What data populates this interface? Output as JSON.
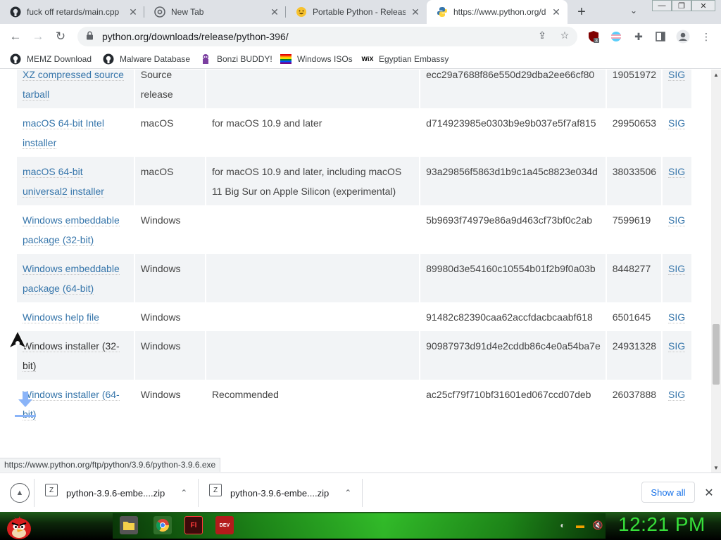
{
  "tabs": [
    {
      "title": "fuck off retards/main.cpp",
      "icon": "github-icon"
    },
    {
      "title": "New Tab",
      "icon": "chrome-icon"
    },
    {
      "title": "Portable Python - Release",
      "icon": "emoji-face-icon"
    },
    {
      "title": "https://www.python.org/d",
      "icon": "python-icon",
      "active": true
    }
  ],
  "address_bar": {
    "url": "python.org/downloads/release/python-396/"
  },
  "extensions": {
    "ublock_badge": "3"
  },
  "bookmarks": [
    {
      "label": "MEMZ Download",
      "icon": "github-icon"
    },
    {
      "label": "Malware Database",
      "icon": "github-icon"
    },
    {
      "label": "Bonzi BUDDY!",
      "icon": "bonzi-icon"
    },
    {
      "label": "Windows ISOs",
      "icon": "rainbow-flag-icon"
    },
    {
      "label": "Egyptian Embassy",
      "icon": "wix-icon"
    }
  ],
  "files": [
    {
      "version": "XZ compressed source tarball",
      "os": "Source release",
      "description": "",
      "md5": "ecc29a7688f86e550d29dba2ee66cf80",
      "size": "19051972",
      "sig": "SIG"
    },
    {
      "version": "macOS 64-bit Intel installer",
      "os": "macOS",
      "description": "for macOS 10.9 and later",
      "md5": "d714923985e0303b9e9b037e5f7af815",
      "size": "29950653",
      "sig": "SIG"
    },
    {
      "version": "macOS 64-bit universal2 installer",
      "os": "macOS",
      "description": "for macOS 10.9 and later, including macOS 11 Big Sur on Apple Silicon (experimental)",
      "md5": "93a29856f5863d1b9c1a45c8823e034d",
      "size": "38033506",
      "sig": "SIG"
    },
    {
      "version": "Windows embeddable package (32-bit)",
      "os": "Windows",
      "description": "",
      "md5": "5b9693f74979e86a9d463cf73bf0c2ab",
      "size": "7599619",
      "sig": "SIG"
    },
    {
      "version": "Windows embeddable package (64-bit)",
      "os": "Windows",
      "description": "",
      "md5": "89980d3e54160c10554b01f2b9f0a03b",
      "size": "8448277",
      "sig": "SIG"
    },
    {
      "version": "Windows help file",
      "os": "Windows",
      "description": "",
      "md5": "91482c82390caa62accfdacbcaabf618",
      "size": "6501645",
      "sig": "SIG"
    },
    {
      "version": "Windows installer (32-bit)",
      "os": "Windows",
      "description": "",
      "md5": "90987973d91d4e2cddb86c4e0a54ba7e",
      "size": "24931328",
      "sig": "SIG"
    },
    {
      "version": "Windows installer (64-bit)",
      "os": "Windows",
      "description": "Recommended",
      "md5": "ac25cf79f710bf31601ed067ccd07deb",
      "size": "26037888",
      "sig": "SIG"
    }
  ],
  "status_url": "https://www.python.org/ftp/python/3.9.6/python-3.9.6.exe",
  "downloads": [
    {
      "name": "python-3.9.6-embe....zip"
    },
    {
      "name": "python-3.9.6-embe....zip"
    }
  ],
  "download_shelf": {
    "show_all": "Show all"
  },
  "taskbar": {
    "clock": "12:21 PM"
  }
}
